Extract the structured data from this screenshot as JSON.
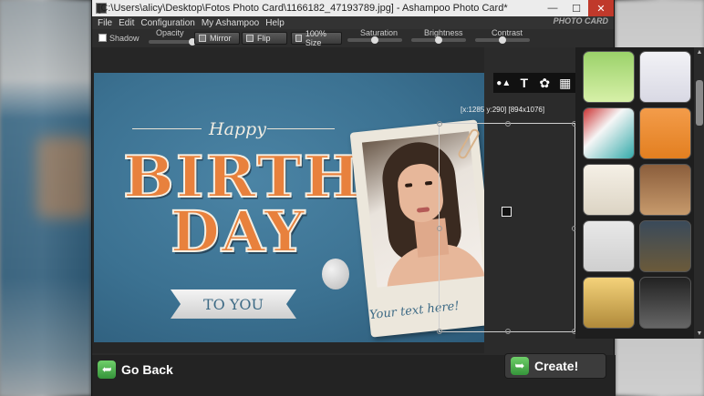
{
  "window": {
    "title": "[C:\\Users\\alicy\\Desktop\\Fotos Photo Card\\1166182_47193789.jpg] - Ashampoo Photo Card*",
    "min_glyph": "—",
    "max_glyph": "☐",
    "close_glyph": "✕"
  },
  "menu": {
    "items": [
      "File",
      "Edit",
      "Configuration",
      "My Ashampoo",
      "Help"
    ],
    "brand": "PHOTO CARD"
  },
  "toolbar": {
    "shadow_label": "Shadow",
    "opacity_label": "Opacity",
    "mirror_label": "Mirror",
    "flip_label": "Flip",
    "size_label": "100% Size",
    "saturation_label": "Saturation",
    "brightness_label": "Brightness",
    "contrast_label": "Contrast"
  },
  "card": {
    "happy": "Happy",
    "birth": "BIRTH",
    "day": "DAY",
    "ribbon": "TO YOU",
    "your_text": "Your text here!",
    "selection_coords": "[x:1285 y:290] [894x1076]"
  },
  "canvas_tools": {
    "shapes_glyph": "●▲",
    "text_glyph": "T",
    "clip_glyph": "✿",
    "image_glyph": "▦"
  },
  "bottom": {
    "go_back": "Go Back",
    "create": "Create!",
    "arrow_glyph": "➥"
  },
  "colors": {
    "card_blue": "#3b7191",
    "title_orange": "#e8813d",
    "create_green": "#35943a"
  }
}
